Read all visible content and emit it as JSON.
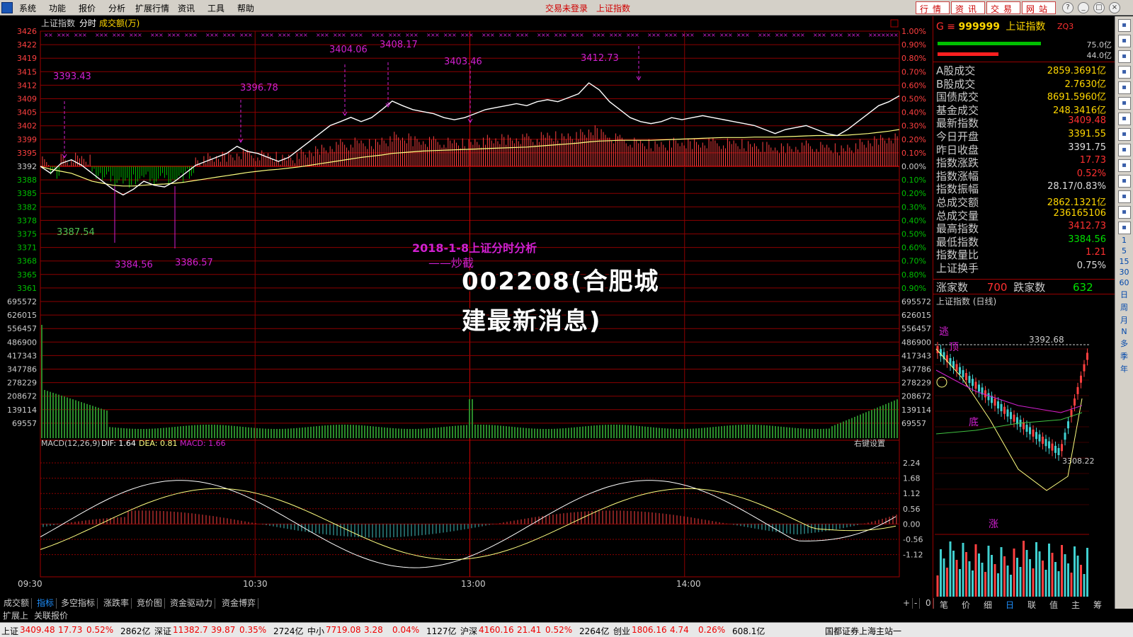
{
  "menubar": {
    "items": [
      "系统",
      "功能",
      "报价",
      "分析",
      "扩展行情",
      "资讯",
      "工具",
      "帮助"
    ],
    "status1": "交易未登录",
    "status2": "上证指数",
    "tab_buttons": [
      "行情",
      "资讯",
      "交易",
      "网站"
    ]
  },
  "chart_header": {
    "title": "上证指数",
    "mode": "分时",
    "volume_label": "成交额(万)"
  },
  "headline": "2018-1-8上证分时分析",
  "subheadline": "——炒截",
  "watermark": [
    "002208(合肥城",
    "建最新消息)"
  ],
  "price_axis_left": [
    "3426",
    "3422",
    "3419",
    "3415",
    "3412",
    "3409",
    "3405",
    "3402",
    "3399",
    "3395",
    "3392",
    "3388",
    "3385",
    "3382",
    "3378",
    "3375",
    "3371",
    "3368",
    "3365",
    "3361"
  ],
  "pct_axis_right": [
    "1.00%",
    "0.90%",
    "0.80%",
    "0.70%",
    "0.60%",
    "0.50%",
    "0.40%",
    "0.30%",
    "0.20%",
    "0.10%",
    "0.00%",
    "0.10%",
    "0.20%",
    "0.30%",
    "0.40%",
    "0.50%",
    "0.60%",
    "0.70%",
    "0.80%",
    "0.90%"
  ],
  "volume_axis": [
    "695572",
    "626015",
    "556457",
    "486900",
    "417343",
    "347786",
    "278229",
    "208672",
    "139114",
    "69557"
  ],
  "macd_axis": [
    "2.24",
    "1.68",
    "1.12",
    "0.56",
    "0.00",
    "-0.56",
    "-1.12"
  ],
  "macd_header": {
    "name": "MACD(12,26,9)",
    "dif": "DIF: 1.64",
    "dea": "DEA: 0.81",
    "macd": "MACD: 1.66",
    "setting": "右键设置"
  },
  "time_axis": [
    "09:30",
    "10:30",
    "13:00",
    "14:00"
  ],
  "annotations": [
    "3393.43",
    "3396.78",
    "3404.06",
    "3408.17",
    "3403.46",
    "3412.73",
    "3387.54",
    "3384.56",
    "3386.57"
  ],
  "bottom_tabs": [
    "成交额",
    "指标",
    "多空指标",
    "涨跌率",
    "竞价图",
    "资金驱动力",
    "资金博弈"
  ],
  "bottom_tabs2": [
    "扩展上",
    "关联报价"
  ],
  "bottom_controls": [
    "+",
    "-",
    "0"
  ],
  "right_panel": {
    "code": "999999",
    "name": "上证指数",
    "zq": "ZQ3",
    "vol_top": "75.0亿",
    "vol_bottom": "44.0亿",
    "rows": [
      {
        "label": "A股成交",
        "value": "2859.3691亿",
        "color": "#ffd700"
      },
      {
        "label": "B股成交",
        "value": "2.7630亿",
        "color": "#ffd700"
      },
      {
        "label": "国债成交",
        "value": "8691.5960亿",
        "color": "#ffd700"
      },
      {
        "label": "基金成交",
        "value": "248.3416亿",
        "color": "#ffd700"
      },
      {
        "label": "最新指数",
        "value": "3409.48",
        "color": "#ff3030"
      },
      {
        "label": "今日开盘",
        "value": "3391.55",
        "color": "#ffd700"
      },
      {
        "label": "昨日收盘",
        "value": "3391.75",
        "color": "#dddddd"
      },
      {
        "label": "指数涨跌",
        "value": "17.73",
        "color": "#ff3030"
      },
      {
        "label": "指数涨幅",
        "value": "0.52%",
        "color": "#ff3030"
      },
      {
        "label": "指数振幅",
        "value": "28.17/0.83%",
        "color": "#dddddd"
      },
      {
        "label": "总成交额",
        "value": "2862.1321亿",
        "color": "#ffd700"
      },
      {
        "label": "总成交量",
        "value": "236165106",
        "color": "#ffd700"
      },
      {
        "label": "最高指数",
        "value": "3412.73",
        "color": "#ff3030"
      },
      {
        "label": "最低指数",
        "value": "3384.56",
        "color": "#00e000"
      },
      {
        "label": "指数量比",
        "value": "1.21",
        "color": "#ff3030"
      },
      {
        "label": "上证换手",
        "value": "0.75%",
        "color": "#dddddd"
      }
    ],
    "rise_label": "涨家数",
    "rise_value": "700",
    "fall_label": "跌家数",
    "fall_value": "632",
    "mini_title": "上证指数 (日线)",
    "mini_price_high": "3392.68",
    "mini_price_low": "3308.22",
    "mini_text": [
      "逃",
      "顶",
      "底",
      "涨"
    ],
    "bottom_tabs": [
      "笔",
      "价",
      "细",
      "日",
      "联",
      "值",
      "主",
      "筹"
    ]
  },
  "side_toolbar": [
    "1",
    "5",
    "15",
    "30",
    "60",
    "日",
    "周",
    "月",
    "N",
    "多",
    "季",
    "年"
  ],
  "ticker": [
    {
      "name": "上证",
      "value": "3409.48",
      "chg": "17.73",
      "pct": "0.52%",
      "amt": "2862亿"
    },
    {
      "name": "深证",
      "value": "11382.7",
      "chg": "39.87",
      "pct": "0.35%",
      "amt": "2724亿"
    },
    {
      "name": "中小",
      "value": "7719.08",
      "chg": "3.28",
      "pct": "0.04%",
      "amt": "1127亿"
    },
    {
      "name": "沪深",
      "value": "4160.16",
      "chg": "21.41",
      "pct": "0.52%",
      "amt": "2264亿"
    },
    {
      "name": "创业",
      "value": "1806.16",
      "chg": "4.74",
      "pct": "0.26%",
      "amt": "608.1亿"
    }
  ],
  "ticker_broker": "国都证券上海主站一",
  "colors": {
    "grid": "#8b0000",
    "price_line": "#ffffff",
    "avg_line": "#ffff80",
    "up": "#ff4040",
    "down": "#00c000",
    "macd_up": "#ff4040",
    "macd_down": "#40c0c0",
    "annotation": "#d020d0",
    "volume_bar": "#2a8a2a"
  }
}
